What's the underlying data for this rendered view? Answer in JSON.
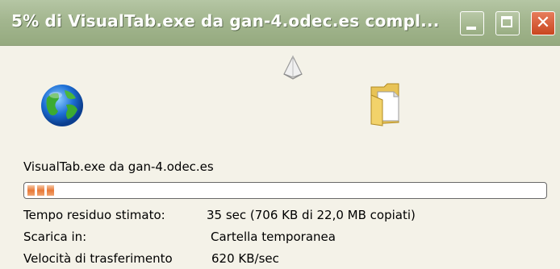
{
  "window": {
    "title": "5% di VisualTab.exe da gan-4.odec.es compl...",
    "buttons": {
      "minimize": "minimize",
      "maximize": "maximize",
      "close": "✕"
    }
  },
  "download": {
    "filename_source": "VisualTab.exe da gan-4.odec.es",
    "progress": {
      "fraction": 0.05,
      "segments": 3,
      "color": "#e87938"
    },
    "time_label": "Tempo residuo stimato:",
    "time_value": "35 sec (706 KB di 22,0 MB copiati)",
    "dest_label": "Scarica in:",
    "dest_value": "Cartella temporanea",
    "speed_label": "Velocità di trasferimento",
    "speed_value": "620 KB/sec"
  },
  "icons": {
    "globe": "globe-icon",
    "paper": "flying-document-icon",
    "folder": "folder-icon"
  },
  "colors": {
    "titlebar": "#a3b68f",
    "close_button": "#c9461f",
    "progress_fill": "#e87938"
  }
}
